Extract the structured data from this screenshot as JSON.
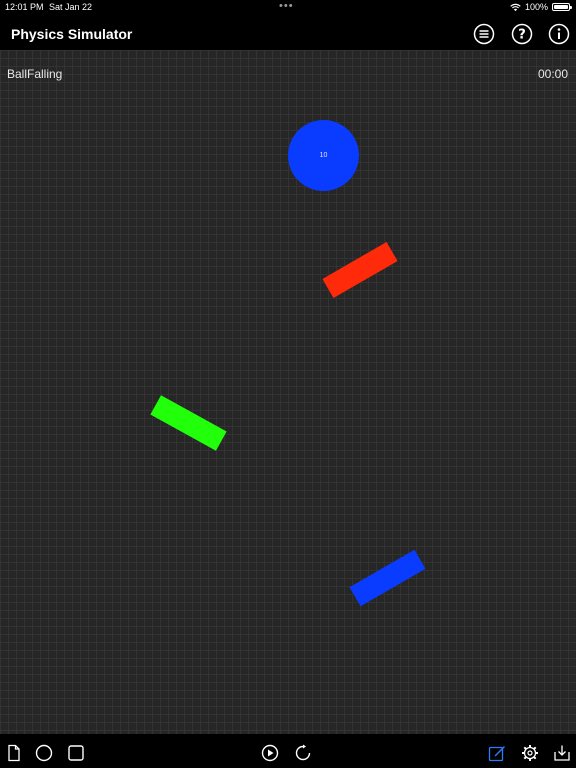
{
  "status_bar": {
    "time": "12:01 PM",
    "date": "Sat Jan 22",
    "battery": "100%",
    "battery_level": 1.0
  },
  "nav": {
    "title": "Physics Simulator",
    "icons": [
      "list-icon",
      "help-icon",
      "info-icon"
    ]
  },
  "scene": {
    "name": "BallFalling",
    "timer": "00:00",
    "ball": {
      "label": "10",
      "color": "#0a3cff"
    },
    "planks": [
      {
        "id": "red",
        "color": "#ff2a0a"
      },
      {
        "id": "green",
        "color": "#22ff0a"
      },
      {
        "id": "blue",
        "color": "#0a3cff"
      }
    ]
  },
  "toolbar": {
    "left_tools": [
      "new-document-icon",
      "circle-tool-icon",
      "square-tool-icon"
    ],
    "center_tools": [
      "play-icon",
      "reset-icon"
    ],
    "right_tools": [
      "edit-icon",
      "settings-icon",
      "export-icon"
    ],
    "active_color": "#2f7bff"
  }
}
